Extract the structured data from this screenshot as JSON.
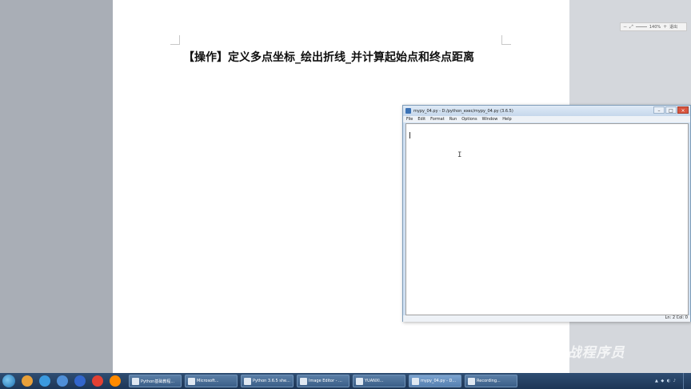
{
  "document": {
    "heading": "【操作】定义多点坐标_绘出折线_并计算起始点和终点距离"
  },
  "zoom": {
    "level": "140%",
    "label": "退出"
  },
  "idle_window": {
    "title": "mypy_04.py - D:/python_exec/mypy_04.py (3.6.5)",
    "menu": [
      "File",
      "Edit",
      "Format",
      "Run",
      "Options",
      "Window",
      "Help"
    ],
    "status": "Ln: 2  Col: 0",
    "controls": {
      "minimize": "–",
      "maximize": "□",
      "close": "×"
    }
  },
  "watermark": "尚学堂·百战程序员",
  "taskbar": {
    "tasks": [
      "Python基础教程...",
      "Microsoft...",
      "Python 3.6.5 she...",
      "Image Editor - ...",
      "YUANXI...",
      "mypy_04.py - D...",
      "Recording..."
    ],
    "tray_icons": "▲ ◆ ◐ ♪",
    "clock": ""
  },
  "icons": {
    "start": "windows-start-icon",
    "pins": [
      "360-icon",
      "ie-icon",
      "k-icon",
      "baidu-netdisk-icon",
      "chrome-icon",
      "firefox-icon"
    ]
  }
}
